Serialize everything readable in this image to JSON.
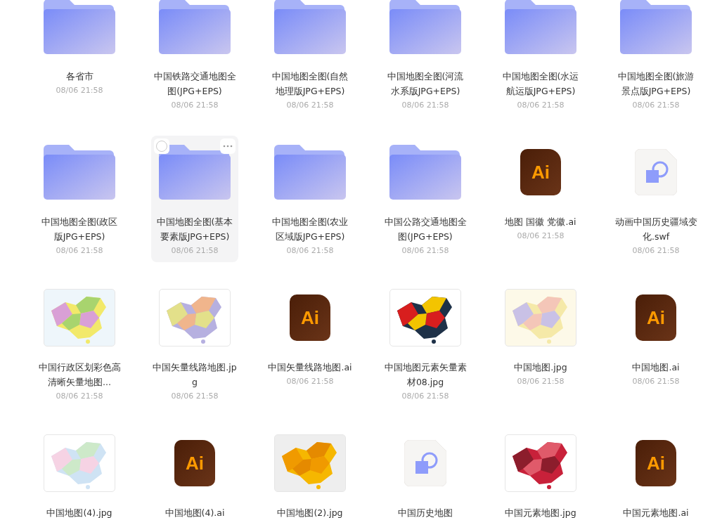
{
  "items": [
    {
      "kind": "folder",
      "name": "各省市",
      "date": "08/06 21:58",
      "hovered": false
    },
    {
      "kind": "folder",
      "name": "中国铁路交通地图全图(JPG+EPS)",
      "date": "08/06 21:58",
      "hovered": false
    },
    {
      "kind": "folder",
      "name": "中国地图全图(自然地理版JPG+EPS)",
      "date": "08/06 21:58",
      "hovered": false
    },
    {
      "kind": "folder",
      "name": "中国地图全图(河流水系版JPG+EPS)",
      "date": "08/06 21:58",
      "hovered": false
    },
    {
      "kind": "folder",
      "name": "中国地图全图(水运航运版JPG+EPS)",
      "date": "08/06 21:58",
      "hovered": false
    },
    {
      "kind": "folder",
      "name": "中国地图全图(旅游景点版JPG+EPS)",
      "date": "08/06 21:58",
      "hovered": false
    },
    {
      "kind": "folder",
      "name": "中国地图全图(政区版JPG+EPS)",
      "date": "08/06 21:58",
      "hovered": false
    },
    {
      "kind": "folder",
      "name": "中国地图全图(基本要素版JPG+EPS)",
      "date": "08/06 21:58",
      "hovered": true
    },
    {
      "kind": "folder",
      "name": "中国地图全图(农业区域版JPG+EPS)",
      "date": "08/06 21:58",
      "hovered": false
    },
    {
      "kind": "folder",
      "name": "中国公路交通地图全图(JPG+EPS)",
      "date": "08/06 21:58",
      "hovered": false
    },
    {
      "kind": "ai",
      "badge": "Ai",
      "name": "地图 国徽 党徽.ai",
      "date": "08/06 21:58",
      "hovered": false
    },
    {
      "kind": "swf",
      "name": "动画中国历史疆域变化.swf",
      "date": "08/06 21:58",
      "hovered": false
    },
    {
      "kind": "picture",
      "name": "中国行政区划彩色高清晰矢量地图...",
      "date": "08/06 21:58",
      "hovered": false
    },
    {
      "kind": "picture",
      "name": "中国矢量线路地图.jpg",
      "date": "08/06 21:58",
      "hovered": false
    },
    {
      "kind": "ai",
      "badge": "Ai",
      "name": "中国矢量线路地图.ai",
      "date": "08/06 21:58",
      "hovered": false
    },
    {
      "kind": "picture",
      "name": "中国地图元素矢量素材08.jpg",
      "date": "08/06 21:58",
      "hovered": false
    },
    {
      "kind": "picture",
      "name": "中国地图.jpg",
      "date": "08/06 21:58",
      "hovered": false
    },
    {
      "kind": "ai",
      "badge": "Ai",
      "name": "中国地图.ai",
      "date": "08/06 21:58",
      "hovered": false
    },
    {
      "kind": "picture",
      "name": "中国地图(4).jpg",
      "hovered": false
    },
    {
      "kind": "ai",
      "badge": "Ai",
      "name": "中国地图(4).ai",
      "hovered": false
    },
    {
      "kind": "picture",
      "name": "中国地图(2).jpg",
      "hovered": false
    },
    {
      "kind": "swf",
      "name": "中国历史地图",
      "hovered": false
    },
    {
      "kind": "picture",
      "name": "中国元素地图.jpg",
      "hovered": false
    },
    {
      "kind": "ai",
      "badge": "Ai",
      "name": "中国元素地图.ai",
      "hovered": false
    }
  ]
}
